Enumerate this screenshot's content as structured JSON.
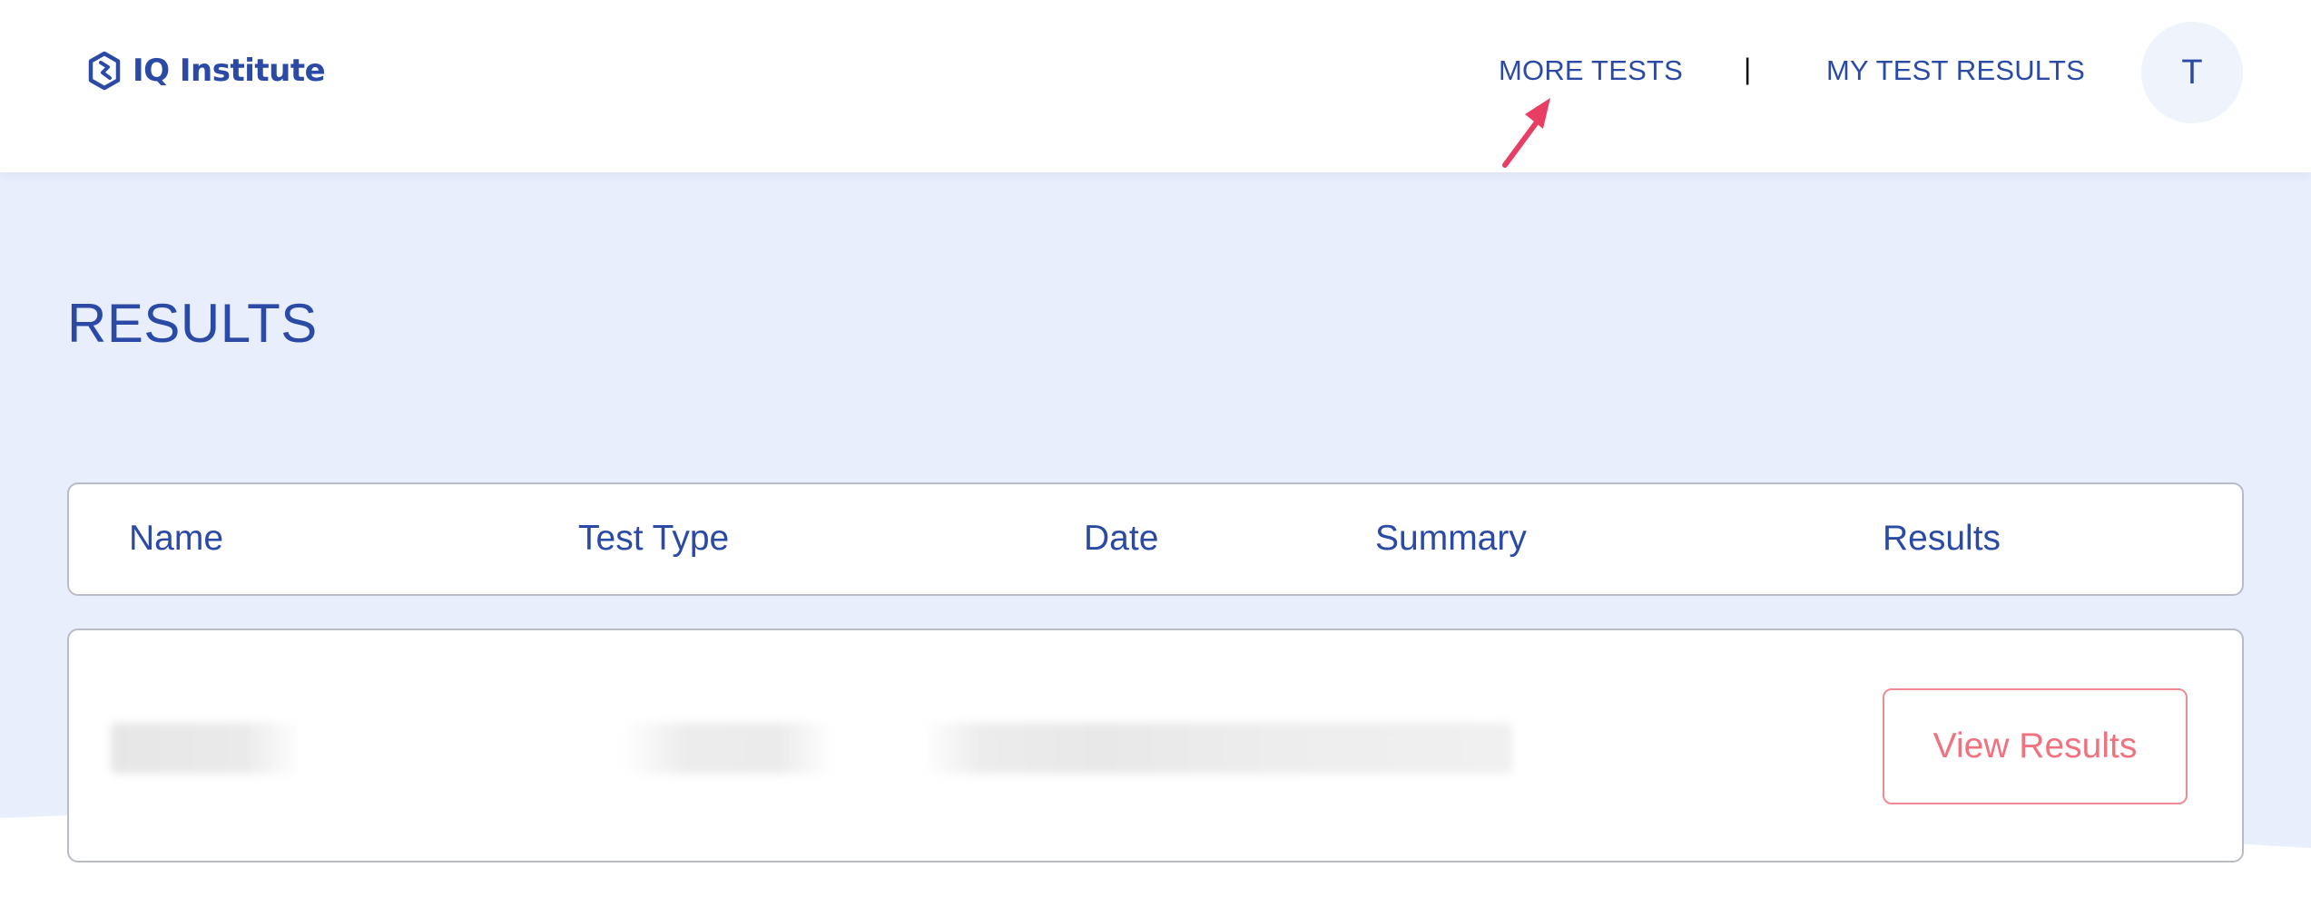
{
  "header": {
    "logo_text": "IQ Institute",
    "logo_icon": "hexagon-logo-icon",
    "nav": {
      "more_tests": "MORE TESTS",
      "separator": "|",
      "my_test_results": "MY TEST RESULTS"
    },
    "avatar_initial": "T"
  },
  "annotation": {
    "icon": "arrow-pointer-icon",
    "color": "#e83e63"
  },
  "main": {
    "title": "RESULTS",
    "table": {
      "columns": [
        "Name",
        "Test Type",
        "Date",
        "Summary",
        "Results"
      ],
      "rows": [
        {
          "name": "",
          "test_type": "",
          "date": "",
          "summary": "",
          "results_button": "View Results"
        }
      ]
    }
  },
  "colors": {
    "brand_blue": "#2b4aa6",
    "background_band": "#e8eefc",
    "button_accent": "#f0727f",
    "avatar_bg": "#eef3fc"
  }
}
